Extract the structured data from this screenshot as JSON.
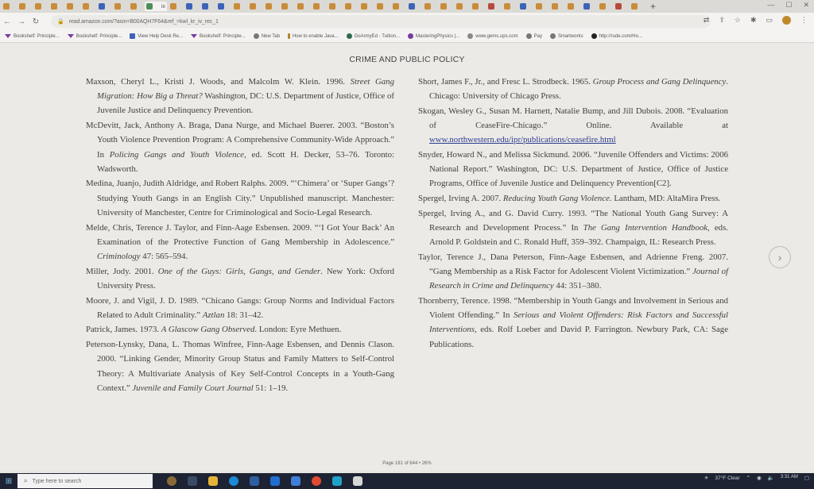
{
  "browser": {
    "url": "read.amazon.com/?asin=B00AQH7F64&ref_=kwl_kr_iv_rec_1",
    "tabs": [
      "ix"
    ],
    "bookmarks": [
      {
        "label": "Bookshelf: Principle..."
      },
      {
        "label": "Bookshelf: Principle..."
      },
      {
        "label": "View Help Desk Re..."
      },
      {
        "label": "Bookshelf: Principle..."
      },
      {
        "label": "New Tab"
      },
      {
        "label": "How to enable Java..."
      },
      {
        "label": "GoArmyEd - Tuition..."
      },
      {
        "label": "MasteringPhysics |..."
      },
      {
        "label": "www.gems.ups.com"
      },
      {
        "label": "Pay"
      },
      {
        "label": "Smartworks"
      },
      {
        "label": "http://rude.com/Ho..."
      }
    ]
  },
  "reader": {
    "header": "CRIME AND PUBLIC POLICY",
    "footer": "Page 181 of 644 • 26%",
    "left_column": [
      {
        "pre": "Maxson, Cheryl L., Kristi J. Woods, and Malcolm W. Klein. 1996. ",
        "title": "Street Gang Migration: How Big a Threat?",
        "post": " Washington, DC: U.S. Department of Justice, Office of Juvenile Justice and Delinquency Prevention."
      },
      {
        "pre": "McDevitt, Jack, Anthony A. Braga, Dana Nurge, and Michael Buerer. 2003. “Boston’s Youth Violence Prevention Program: A Comprehensive Community-Wide Approach.” In ",
        "title": "Policing Gangs and Youth Violence",
        "post": ", ed. Scott H. Decker, 53–76. Toronto: Wadsworth."
      },
      {
        "pre": "Medina, Juanjo, Judith Aldridge, and Robert Ralphs. 2009. “‘Chimera’ or ‘Super Gangs’? Studying Youth Gangs in an English City.” Unpublished manuscript. Manchester: University of Manchester, Centre for Criminological and Socio-Legal Research.",
        "title": "",
        "post": ""
      },
      {
        "pre": "Melde, Chris, Terence J. Taylor, and Finn-Aage Esbensen. 2009. “‘I Got Your Back’ An Examination of the Protective Function of Gang Membership in Adolescence.” ",
        "title": "Criminology",
        "post": " 47: 565–594."
      },
      {
        "pre": "Miller, Jody. 2001. ",
        "title": "One of the Guys: Girls, Gangs, and Gender",
        "post": ". New York: Oxford University Press."
      },
      {
        "pre": "Moore, J. and Vigil, J. D. 1989. “Chicano Gangs: Group Norms and Individual Factors Related to Adult Criminality.” ",
        "title": "Aztlan",
        "post": " 18: 31–42."
      },
      {
        "pre": "Patrick, James. 1973. ",
        "title": "A Glascow Gang Observed",
        "post": ". London: Eyre Methuen."
      },
      {
        "pre": "Peterson-Lynsky, Dana, L. Thomas Winfree, Finn-Aage Esbensen, and Dennis Clason. 2000. “Linking Gender, Minority Group Status and Family Matters to Self-Control Theory: A Multivariate Analysis of Key Self-Control Concepts in a Youth-Gang Context.” ",
        "title": "Juvenile and Family Court Journal",
        "post": " 51: 1–19."
      }
    ],
    "right_column": [
      {
        "pre": "Short, James F., Jr., and Fresc L. Strodbeck. 1965. ",
        "title": "Group Process and Gang Delinquency",
        "post": ". Chicago: University of Chicago Press.",
        "link": ""
      },
      {
        "pre": "Skogan, Wesley G., Susan M. Harnett, Natalie Bump, and Jill Dubois. 2008. “Evaluation of CeaseFire-Chicago.” Online. Available at ",
        "title": "",
        "post": "",
        "link": "www.northwestern.edu/ipr/publications/ceasefire.html"
      },
      {
        "pre": "Snyder, Howard N., and Melissa Sickmund. 2006. “Juvenile Offenders and Victims: 2006 National Report.” Washington, DC: U.S. Department of Justice, Office of Justice Programs, Office of Juvenile Justice and Delinquency Prevention[C2].",
        "title": "",
        "post": "",
        "link": ""
      },
      {
        "pre": "Spergel, Irving A. 2007. ",
        "title": "Reducing Youth Gang Violence",
        "post": ". Lantham, MD: AltaMira Press.",
        "link": ""
      },
      {
        "pre": "Spergel, Irving A., and G. David Curry. 1993. “The National Youth Gang Survey: A Research and Development Process.” In ",
        "title": "The Gang Intervention Handbook",
        "post": ", eds. Arnold P. Goldstein and C. Ronald Huff, 359–392. Champaign, IL: Research Press.",
        "link": ""
      },
      {
        "pre": "Taylor, Terence J., Dana Peterson, Finn-Aage Esbensen, and Adrienne Freng. 2007. “Gang Membership as a Risk Factor for Adolescent Violent Victimization.” ",
        "title": "Journal of Research in Crime and Delinquency",
        "post": " 44: 351–380.",
        "link": ""
      },
      {
        "pre": "Thornberry, Terence. 1998. “Membership in Youth Gangs and Involvement in Serious and Violent Offending.” In ",
        "title": "Serious and Violent Offenders: Risk Factors and Successful Interventions",
        "post": ", eds. Rolf Loeber and David P. Farrington. Newbury Park, CA: Sage Publications.",
        "link": ""
      }
    ]
  },
  "taskbar": {
    "search_placeholder": "Type here to search",
    "weather": "37°F Clear",
    "time": "3:31 AM",
    "date": ""
  },
  "icons": {
    "back": "back-arrow-icon",
    "forward": "forward-arrow-icon",
    "reload": "reload-icon",
    "next_page": "chevron-right-icon"
  }
}
